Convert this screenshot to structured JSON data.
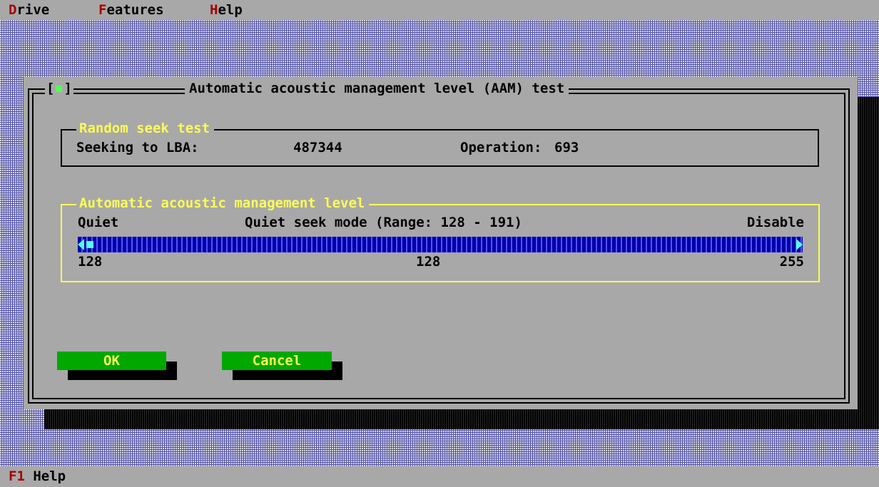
{
  "menu": {
    "items": [
      {
        "hotkey": "D",
        "rest": "rive"
      },
      {
        "hotkey": "F",
        "rest": "eatures"
      },
      {
        "hotkey": "H",
        "rest": "elp"
      }
    ]
  },
  "dialog": {
    "close_box": "[",
    "close_box_end": "]",
    "title": "Automatic acoustic management level (AAM) test",
    "seek_group": {
      "label": "Random seek test",
      "seeking_label": "Seeking to LBA:",
      "seeking_value": "487344",
      "operation_label": "Operation:",
      "operation_value": "693"
    },
    "aam_group": {
      "label": "Automatic acoustic management level",
      "left_label": "Quiet",
      "mode_label": "Quiet seek mode (Range: 128 - 191)",
      "right_label": "Disable",
      "min_value": "128",
      "current_value": "128",
      "max_value": "255",
      "slider_level": 0
    },
    "buttons": {
      "ok": "OK",
      "cancel": "Cancel"
    }
  },
  "status": {
    "hotkey": "F1",
    "label": "Help"
  },
  "colors": {
    "background": "#a8a8a8",
    "hotkey": "#a80000",
    "group_highlight": "#fcfc54",
    "button": "#00a800",
    "slider": "#0000a8",
    "slider_accent": "#54fcfc"
  }
}
